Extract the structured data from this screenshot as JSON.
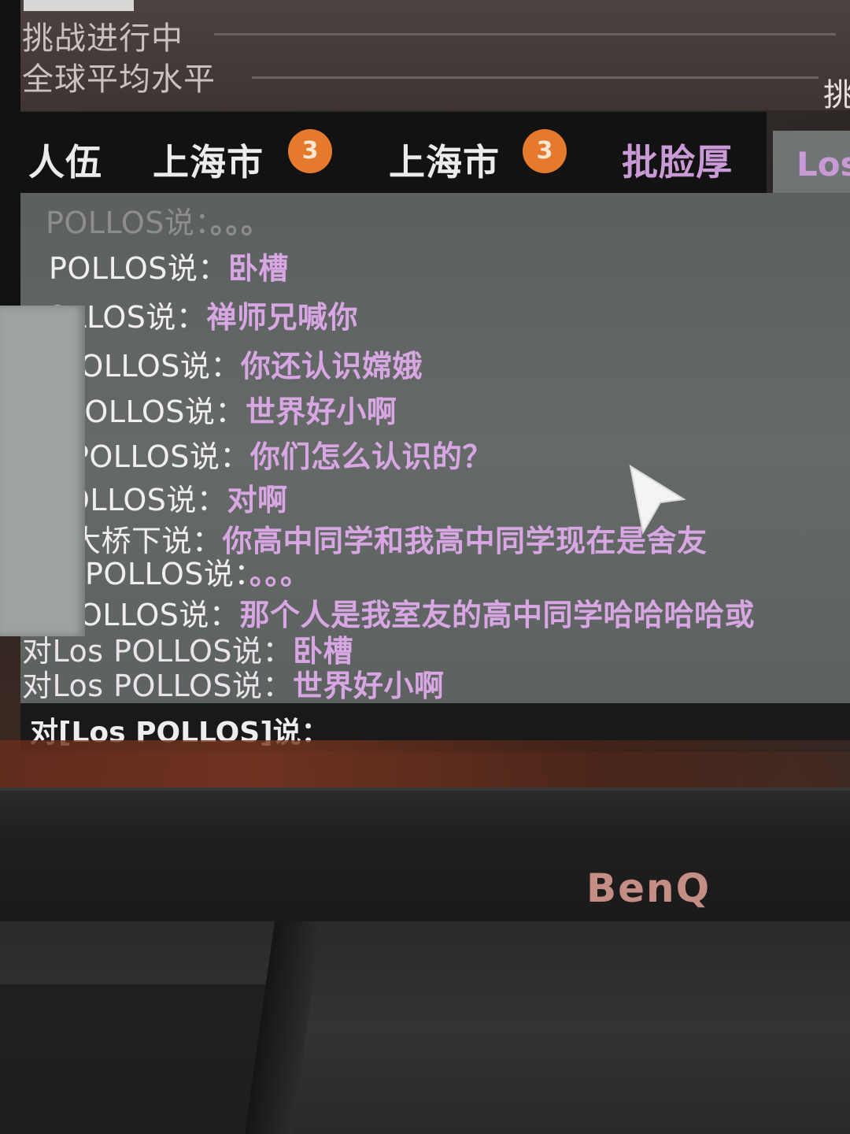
{
  "status": {
    "line1": "挑战进行中",
    "line2": "全球平均水平",
    "right_char": "挑"
  },
  "tabs": [
    {
      "label": "人伍"
    },
    {
      "label": "上海市",
      "badge": "3"
    },
    {
      "label": "上海市",
      "badge": "3"
    },
    {
      "label": "批脸厚"
    },
    {
      "label": "Los"
    }
  ],
  "chat": {
    "messages": [
      {
        "speaker": "POLLOS说：",
        "text": "。。。"
      },
      {
        "speaker": "POLLOS说：",
        "text": "卧槽"
      },
      {
        "speaker": "OLLOS说：",
        "text": "禅师兄喊你"
      },
      {
        "speaker": "POLLOS说：",
        "text": "你还认识嫦娥"
      },
      {
        "speaker": "POLLOS说：",
        "text": "世界好小啊"
      },
      {
        "speaker": "POLLOS说：",
        "text": "你们怎么认识的？"
      },
      {
        "speaker": "OLLOS说：",
        "text": "对啊"
      },
      {
        "speaker": "大桥下说：",
        "text": "你高中同学和我高中同学现在是舍友"
      },
      {
        "speaker": "POLLOS说：",
        "text": "。。。"
      },
      {
        "speaker": "OLLOS说：",
        "text": "那个人是我室友的高中同学哈哈哈哈或"
      },
      {
        "speaker": "对Los POLLOS说：",
        "text": "卧槽"
      },
      {
        "speaker": "对Los POLLOS说：",
        "text": "世界好小啊"
      }
    ]
  },
  "input": {
    "prefix": "对[Los POLLOS]说："
  },
  "monitor": {
    "brand": "BenQ"
  }
}
